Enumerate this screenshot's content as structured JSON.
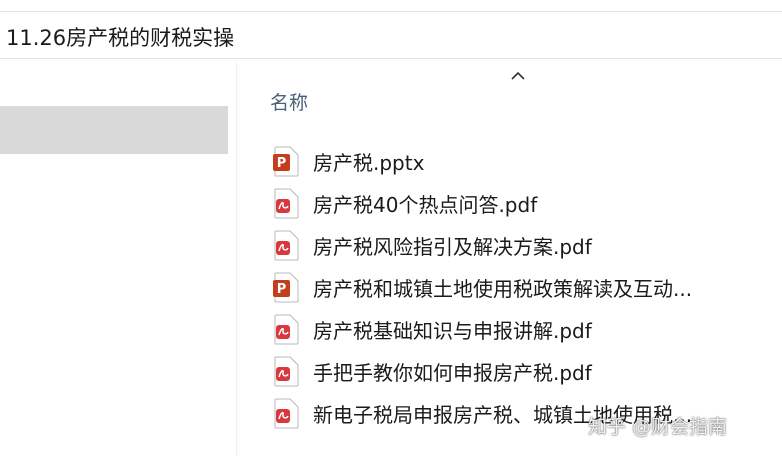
{
  "address_bar": {
    "path": "11.26房产税的财税实操"
  },
  "file_list": {
    "column_header": "名称",
    "sort_direction_icon": "chevron-up-icon",
    "items": [
      {
        "name": "房产税.pptx",
        "icon": "powerpoint-file-icon"
      },
      {
        "name": "房产税40个热点问答.pdf",
        "icon": "pdf-file-icon"
      },
      {
        "name": "房产税风险指引及解决方案.pdf",
        "icon": "pdf-file-icon"
      },
      {
        "name": "房产税和城镇土地使用税政策解读及互动...",
        "icon": "powerpoint-file-icon"
      },
      {
        "name": "房产税基础知识与申报讲解.pdf",
        "icon": "pdf-file-icon"
      },
      {
        "name": "手把手教你如何申报房产税.pdf",
        "icon": "pdf-file-icon"
      },
      {
        "name": "新电子税局申报房产税、城镇土地使用税...",
        "icon": "pdf-file-icon"
      }
    ]
  },
  "watermark": {
    "text": "知乎 @财会指南"
  },
  "colors": {
    "pdf_icon": "#d9383f",
    "pptx_icon": "#c43e1c",
    "nav_selection": "#d9d9d9",
    "header_text": "#4c607a"
  }
}
